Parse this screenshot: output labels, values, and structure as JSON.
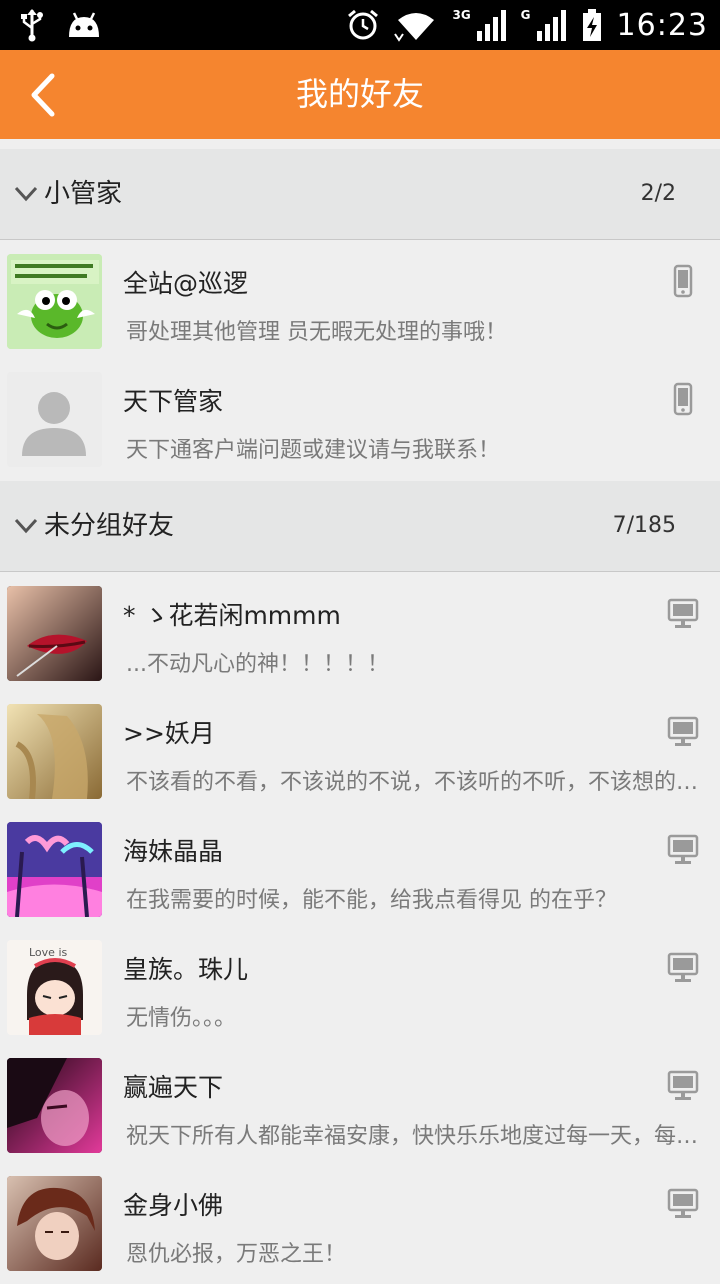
{
  "status_bar": {
    "time": "16:23",
    "network_3g": "3G",
    "network_g": "G",
    "icons": [
      "usb-icon",
      "android-icon",
      "alarm-icon",
      "wifi-icon",
      "signal-icon",
      "battery-charging-icon"
    ]
  },
  "header": {
    "title": "我的好友",
    "back_icon": "chevron-left-icon"
  },
  "groups": [
    {
      "name": "小管家",
      "count": "2/2",
      "contacts": [
        {
          "name": "全站@巡逻",
          "signature": "哥处理其他管理 员无暇无处理的事哦！",
          "device": "phone-icon"
        },
        {
          "name": "天下管家",
          "signature": "天下通客户端问题或建议请与我联系！",
          "device": "phone-icon"
        }
      ]
    },
    {
      "name": "未分组好友",
      "count": "7/185",
      "contacts": [
        {
          "name": "* ゝ花若闲mmmm",
          "signature": "...不动凡心的神！！！！！",
          "device": "computer-icon"
        },
        {
          "name": ">>妖月",
          "signature": "不该看的不看，不该说的不说，不该听的不听，不该想的不想",
          "device": "computer-icon"
        },
        {
          "name": "海妹晶晶",
          "signature": "在我需要的时候，能不能，给我点看得见 的在乎？",
          "device": "computer-icon"
        },
        {
          "name": "皇族。珠儿",
          "signature": "无情伤。。。",
          "device": "computer-icon"
        },
        {
          "name": "赢遍天下",
          "signature": "祝天下所有人都能幸福安康，快快乐乐地度过每一天，每一年",
          "device": "computer-icon"
        },
        {
          "name": "金身小佛",
          "signature": "恩仇必报，万恶之王！",
          "device": "computer-icon"
        }
      ]
    }
  ],
  "colors": {
    "accent": "#f5852f",
    "status_bar": "#000000",
    "background": "#efefef",
    "group_header": "#e5e6e6"
  }
}
